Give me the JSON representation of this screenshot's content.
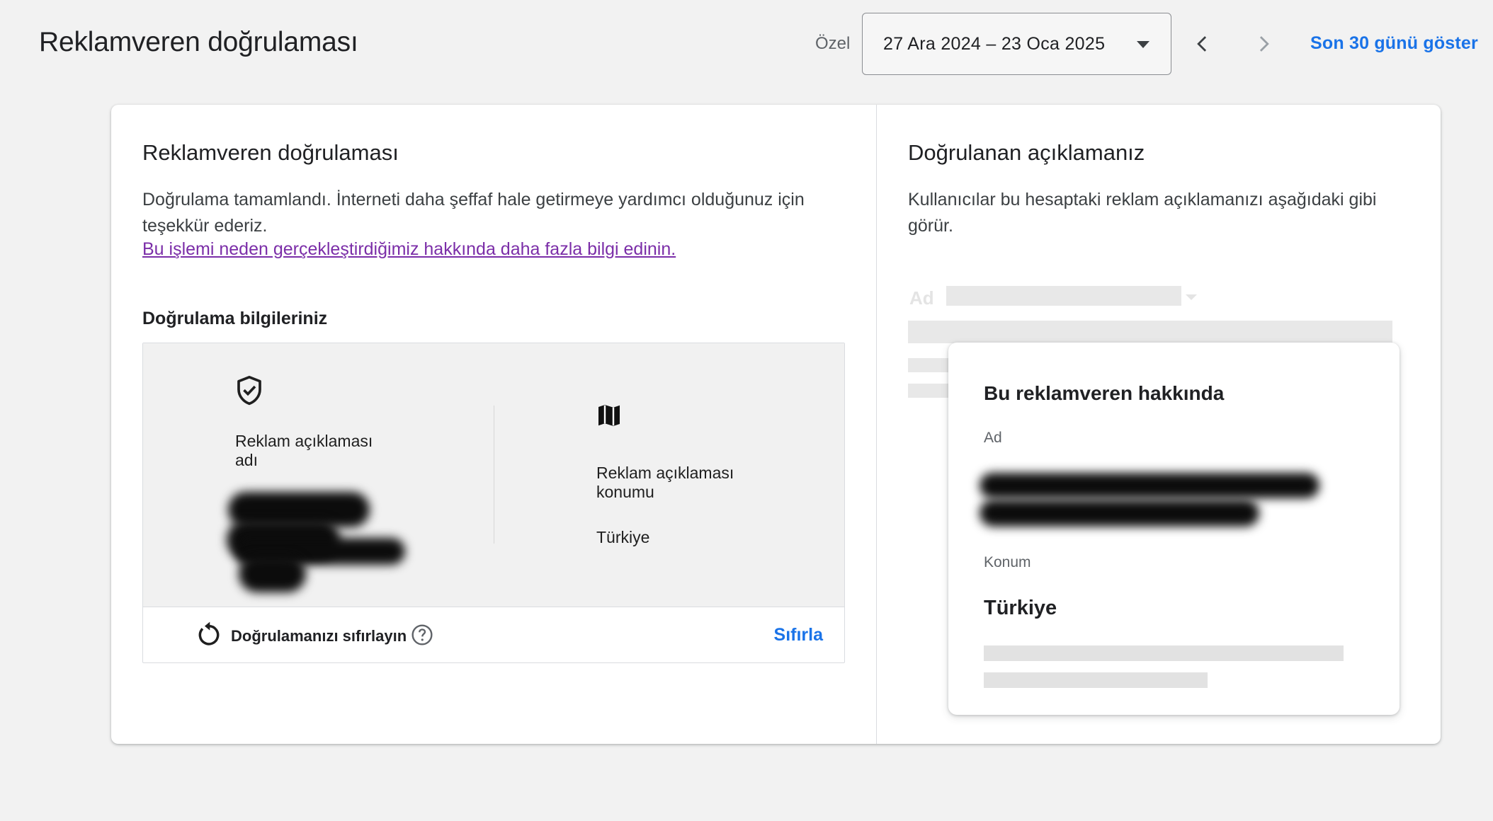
{
  "header": {
    "title": "Reklamveren doğrulaması",
    "period_type": "Özel",
    "date_range": "27 Ara 2024 – 23 Oca 2025",
    "show_last_30": "Son 30 günü göster"
  },
  "left": {
    "title": "Reklamveren doğrulaması",
    "desc_line1": "Doğrulama tamamlandı. İnterneti daha şeffaf hale getirmeye yardımcı olduğunuz için",
    "desc_line2": "teşekkür ederiz.",
    "learn_more": "Bu işlemi neden gerçekleştirdiğimiz hakkında daha fazla bilgi edinin.",
    "info_title": "Doğrulama bilgileriniz",
    "name_label_1": "Reklam açıklaması",
    "name_label_2": "adı",
    "location_label_1": "Reklam açıklaması",
    "location_label_2": "konumu",
    "location_value": "Türkiye",
    "reset_label": "Doğrulamanızı sıfırlayın",
    "reset_button": "Sıfırla"
  },
  "right": {
    "title": "Doğrulanan açıklamanız",
    "desc_line1": "Kullanıcılar bu hesaptaki reklam açıklamanızı aşağıdaki gibi",
    "desc_line2": "görür.",
    "ghost_ad_label": "Ad",
    "about": {
      "title": "Bu reklamveren hakkında",
      "name_label": "Ad",
      "location_label": "Konum",
      "location_value": "Türkiye"
    }
  },
  "colors": {
    "link_blue": "#1a73e8",
    "visited_link": "#7b2ea8"
  },
  "icons": [
    "chevron-left-icon",
    "chevron-right-icon",
    "caret-down-icon",
    "shield-check-icon",
    "map-icon",
    "reset-icon",
    "help-icon"
  ]
}
